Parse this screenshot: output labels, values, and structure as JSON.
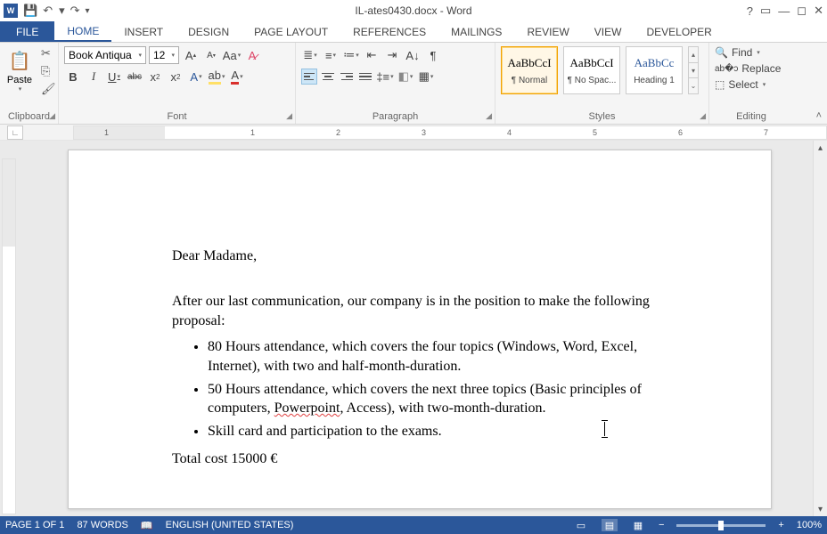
{
  "title": "IL-ates0430.docx - Word",
  "qat": {
    "save_icon": "save",
    "undo_icon": "undo",
    "redo_icon": "redo"
  },
  "tabs": {
    "file": "FILE",
    "items": [
      "HOME",
      "INSERT",
      "DESIGN",
      "PAGE LAYOUT",
      "REFERENCES",
      "MAILINGS",
      "REVIEW",
      "VIEW",
      "DEVELOPER"
    ],
    "active": "HOME"
  },
  "ribbon": {
    "clipboard": {
      "label": "Clipboard",
      "paste": "Paste"
    },
    "font": {
      "label": "Font",
      "name": "Book Antiqua",
      "size": "12"
    },
    "paragraph": {
      "label": "Paragraph"
    },
    "styles": {
      "label": "Styles",
      "items": [
        {
          "preview": "AaBbCcI",
          "name": "¶ Normal",
          "selected": true
        },
        {
          "preview": "AaBbCcI",
          "name": "¶ No Spac...",
          "selected": false
        },
        {
          "preview": "AaBbCc",
          "name": "Heading 1",
          "selected": false,
          "heading": true
        }
      ]
    },
    "editing": {
      "label": "Editing",
      "find": "Find",
      "replace": "Replace",
      "select": "Select"
    }
  },
  "ruler": {
    "marks": [
      "1",
      "1",
      "2",
      "3",
      "4",
      "5",
      "6",
      "7"
    ]
  },
  "document": {
    "greeting": "Dear Madame,",
    "para1": "After our last communication, our company is in the position to make the following proposal:",
    "bullets": [
      "80 Hours attendance, which covers the four topics (Windows, Word, Excel, Internet), with two and half-month-duration.",
      "50 Hours attendance, which covers the next three topics (Basic principles of computers, Powerpoint, Access), with two-month-duration.",
      "Skill card and participation to the exams."
    ],
    "bullet2_pre": "50 Hours attendance, which covers the next three topics (Basic principles of computers, ",
    "bullet2_err": "Powerpoint",
    "bullet2_post": ", Access), with two-month-duration.",
    "total": "Total cost 15000 €"
  },
  "status": {
    "page": "PAGE 1 OF 1",
    "words": "87 WORDS",
    "lang": "ENGLISH (UNITED STATES)",
    "zoom": "100%"
  }
}
